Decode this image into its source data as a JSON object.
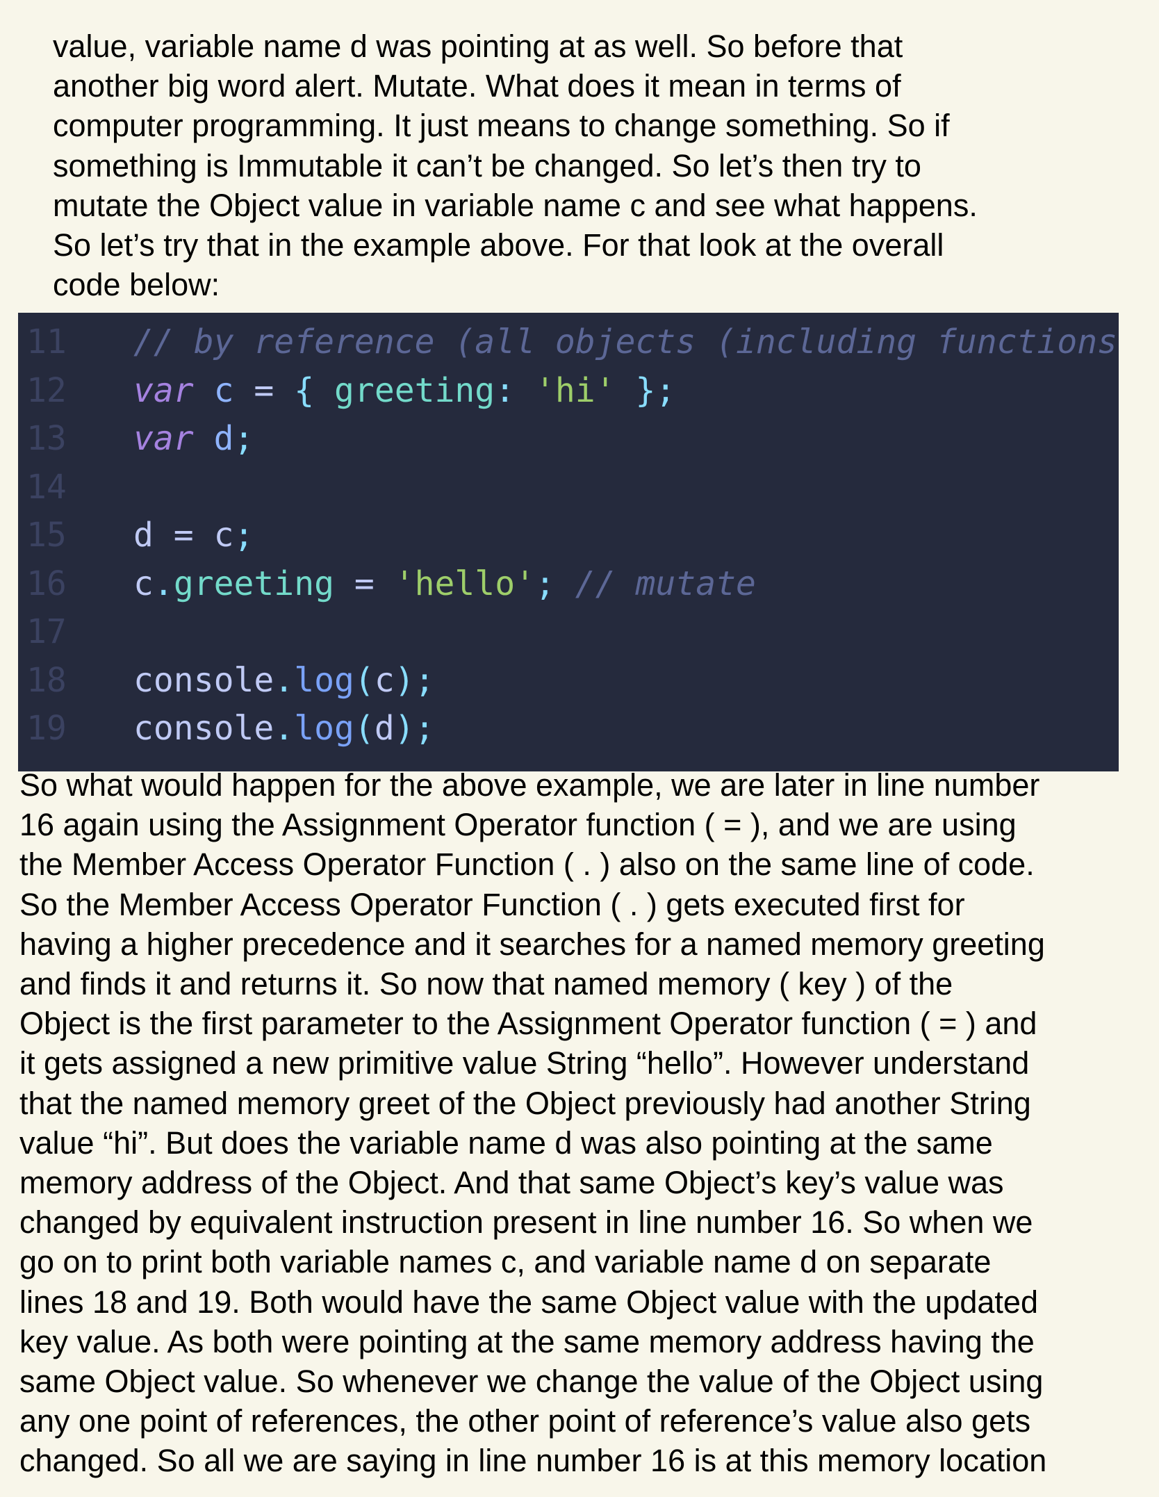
{
  "intro": {
    "lines": [
      "value, variable name d was pointing at as well. So before that",
      "another big word alert. Mutate. What does it mean in terms of",
      "computer programming. It just means to change something. So if",
      "something is Immutable it can’t be changed. So let’s then try to",
      "mutate the Object value in variable name c and see what happens.",
      "So let’s try that in the example above. For that look at the overall",
      "code below:"
    ]
  },
  "code": {
    "lines": [
      {
        "number": "11",
        "tokens": [
          {
            "t": "// by reference (all objects (including functions))",
            "k": "comment"
          }
        ]
      },
      {
        "number": "12",
        "tokens": [
          {
            "t": "var",
            "k": "keyword"
          },
          {
            "t": " c ",
            "k": "var"
          },
          {
            "t": "=",
            "k": "ident"
          },
          {
            "t": " { ",
            "k": "punct"
          },
          {
            "t": "greeting",
            "k": "prop"
          },
          {
            "t": ": ",
            "k": "punct"
          },
          {
            "t": "'hi'",
            "k": "string"
          },
          {
            "t": " };",
            "k": "punct"
          }
        ]
      },
      {
        "number": "13",
        "tokens": [
          {
            "t": "var",
            "k": "keyword"
          },
          {
            "t": " d",
            "k": "var"
          },
          {
            "t": ";",
            "k": "punct"
          }
        ]
      },
      {
        "number": "14",
        "tokens": []
      },
      {
        "number": "15",
        "tokens": [
          {
            "t": "d ",
            "k": "ident"
          },
          {
            "t": "=",
            "k": "ident"
          },
          {
            "t": " c",
            "k": "ident"
          },
          {
            "t": ";",
            "k": "punct"
          }
        ]
      },
      {
        "number": "16",
        "tokens": [
          {
            "t": "c",
            "k": "ident"
          },
          {
            "t": ".",
            "k": "punct"
          },
          {
            "t": "greeting",
            "k": "prop"
          },
          {
            "t": " = ",
            "k": "ident"
          },
          {
            "t": "'hello'",
            "k": "string"
          },
          {
            "t": "; ",
            "k": "punct"
          },
          {
            "t": "// mutate",
            "k": "comment"
          }
        ]
      },
      {
        "number": "17",
        "tokens": []
      },
      {
        "number": "18",
        "tokens": [
          {
            "t": "console",
            "k": "object"
          },
          {
            "t": ".",
            "k": "punct"
          },
          {
            "t": "log",
            "k": "fn"
          },
          {
            "t": "(",
            "k": "punct"
          },
          {
            "t": "c",
            "k": "ident"
          },
          {
            "t": ");",
            "k": "punct"
          }
        ]
      },
      {
        "number": "19",
        "tokens": [
          {
            "t": "console",
            "k": "object"
          },
          {
            "t": ".",
            "k": "punct"
          },
          {
            "t": "log",
            "k": "fn"
          },
          {
            "t": "(",
            "k": "punct"
          },
          {
            "t": "d",
            "k": "ident"
          },
          {
            "t": ");",
            "k": "punct"
          }
        ]
      }
    ]
  },
  "body": {
    "lines": [
      "So what would happen for the above example, we are later in line number",
      "16 again using the Assignment Operator function ( = ), and we are using",
      "the Member Access Operator Function ( . ) also on the same line of code.",
      "So the Member Access Operator Function ( . ) gets executed first for",
      "having a higher precedence and it searches for a named memory greeting",
      "and finds it and returns it. So now that named memory ( key ) of the",
      "Object is the first parameter to the Assignment Operator function ( = ) and",
      "it gets assigned a new primitive value String “hello”. However understand",
      "that the named memory greet of the Object previously had another String",
      "value “hi”. But does the variable name d was also pointing at the same",
      "memory address of the Object. And that same Object’s key’s value was",
      "changed by equivalent instruction present in line number 16. So when we",
      "go on to print both variable names c, and variable name d on separate",
      "lines 18 and 19. Both would have the same Object value with the updated",
      "key value. As both were pointing at the same memory address having the",
      "same Object value. So whenever we change the value of the Object using",
      "any one point of references, the other point of reference’s value also gets",
      "changed. So all we are saying in line number 16 is at this memory location"
    ]
  }
}
